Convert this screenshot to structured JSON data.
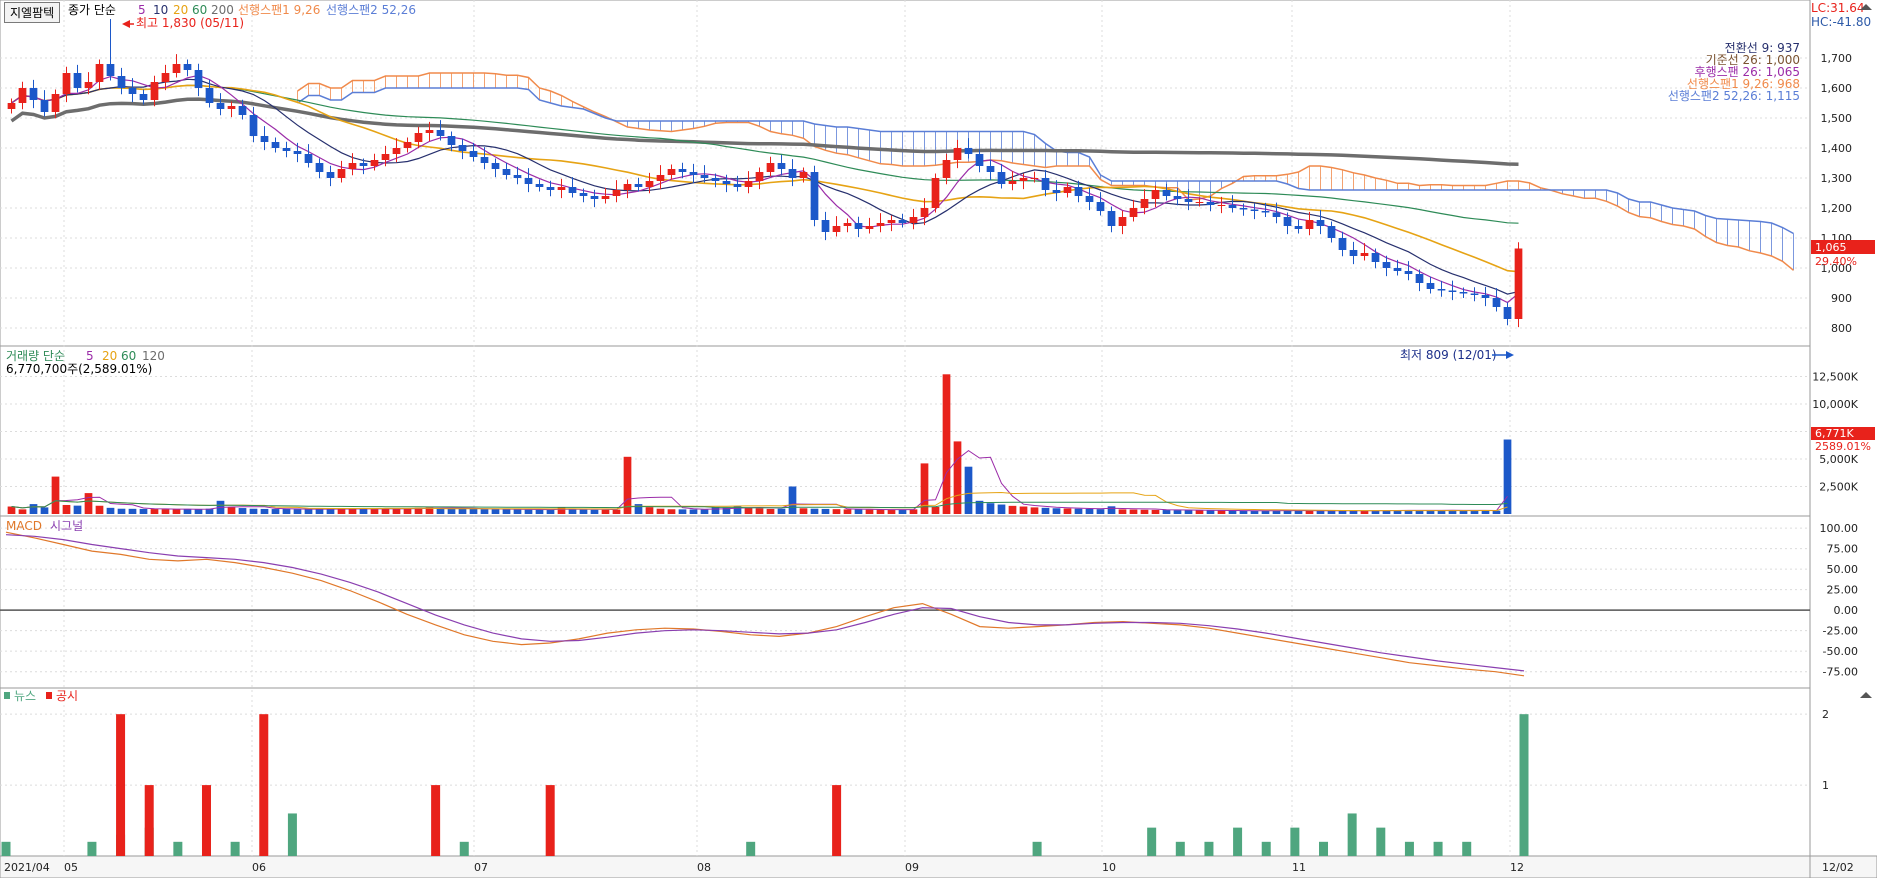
{
  "header": {
    "indicator_button": "지엘팜텍",
    "price_legend_label": "종가 단순",
    "ma_periods": [
      "5",
      "10",
      "20",
      "60",
      "200"
    ],
    "ichimoku_span1_label": "선행스팬1 9,26",
    "ichimoku_span2_label": "선행스팬2 52,26",
    "high_annotation": "최고 1,830 (05/11)",
    "low_annotation": "최저 809 (12/01)",
    "lc_label": "LC:31.64",
    "hc_label": "HC:-41.80"
  },
  "ichimoku_legend": [
    "전환선 9: 937",
    "기준선 26: 1,000",
    "후행스팬 26: 1,065",
    "선행스팬1 9,26: 968",
    "선행스팬2 52,26: 1,115"
  ],
  "current_price": {
    "value": "1,065",
    "change": "29.40%"
  },
  "volume_panel": {
    "legend_label": "거래량 단순",
    "ma_periods": [
      "5",
      "20",
      "60",
      "120"
    ],
    "summary": "6,770,700주(2,589.01%)",
    "current_value": "6,771K",
    "current_change": "2589.01%"
  },
  "macd_panel": {
    "label": "MACD",
    "signal_label": "시그널"
  },
  "news_panel": {
    "news_label": "뉴스",
    "disclosure_label": "공시"
  },
  "colors": {
    "up": "#e8221b",
    "down": "#1c58c9",
    "ma5": "#9b2ca8",
    "ma10": "#27306e",
    "ma20": "#e6a314",
    "ma60": "#2e8b57",
    "ma200": "#6d6d6d",
    "span1": "#f08a4b",
    "span2": "#5b7ed6",
    "macd": "#8a3fb0",
    "signal": "#e0782a",
    "news": "#4fa67f",
    "disclosure": "#e8221b",
    "grid": "#dcdcdc"
  },
  "chart_data": [
    {
      "type": "candlestick",
      "title": "지엘팜텍",
      "x_ticks": [
        "2021/04",
        "05",
        "06",
        "07",
        "08",
        "09",
        "10",
        "11",
        "12",
        "12/02"
      ],
      "y_ticks": [
        "1,700",
        "1,600",
        "1,500",
        "1,400",
        "1,300",
        "1,200",
        "1,100",
        "1,000",
        "900",
        "800"
      ],
      "ylim": [
        760,
        1760
      ],
      "high": 1830,
      "low": 809,
      "last_close": 1065,
      "close": [
        1550,
        1600,
        1560,
        1520,
        1580,
        1650,
        1600,
        1620,
        1680,
        1640,
        1600,
        1580,
        1560,
        1620,
        1650,
        1680,
        1660,
        1600,
        1550,
        1530,
        1540,
        1510,
        1440,
        1420,
        1400,
        1390,
        1380,
        1350,
        1320,
        1300,
        1330,
        1350,
        1340,
        1360,
        1380,
        1400,
        1420,
        1450,
        1460,
        1440,
        1410,
        1390,
        1370,
        1350,
        1330,
        1310,
        1300,
        1280,
        1270,
        1260,
        1270,
        1250,
        1240,
        1230,
        1240,
        1260,
        1280,
        1270,
        1290,
        1310,
        1330,
        1320,
        1310,
        1300,
        1290,
        1280,
        1270,
        1290,
        1320,
        1350,
        1330,
        1300,
        1320,
        1160,
        1120,
        1140,
        1150,
        1130,
        1140,
        1150,
        1160,
        1150,
        1170,
        1200,
        1300,
        1360,
        1400,
        1380,
        1340,
        1320,
        1280,
        1290,
        1300,
        1300,
        1260,
        1250,
        1270,
        1240,
        1220,
        1190,
        1140,
        1170,
        1200,
        1230,
        1260,
        1240,
        1230,
        1220,
        1220,
        1210,
        1210,
        1200,
        1195,
        1190,
        1185,
        1170,
        1140,
        1130,
        1160,
        1140,
        1100,
        1060,
        1040,
        1050,
        1020,
        1000,
        990,
        980,
        950,
        930,
        925,
        920,
        915,
        910,
        900,
        870,
        830,
        1065
      ],
      "volume_k": [
        680,
        420,
        900,
        600,
        3400,
        820,
        760,
        1900,
        750,
        560,
        480,
        470,
        460,
        450,
        440,
        420,
        460,
        430,
        480,
        1200,
        620,
        540,
        480,
        460,
        450,
        470,
        440,
        430,
        420,
        450,
        520,
        460,
        470,
        440,
        460,
        480,
        520,
        560,
        600,
        540,
        500,
        470,
        460,
        440,
        430,
        420,
        410,
        400,
        390,
        380,
        600,
        420,
        400,
        380,
        390,
        400,
        5200,
        900,
        620,
        480,
        430,
        420,
        410,
        400,
        600,
        560,
        700,
        580,
        520,
        460,
        480,
        2500,
        520,
        480,
        460,
        440,
        420,
        410,
        400,
        390,
        380,
        400,
        420,
        4600,
        640,
        12700,
        6600,
        4300,
        1200,
        980,
        860,
        740,
        680,
        600,
        560,
        520,
        500,
        480,
        460,
        440,
        700,
        420,
        400,
        380,
        370,
        360,
        350,
        340,
        330,
        320,
        310,
        300,
        300,
        290,
        300,
        310,
        330,
        300,
        290,
        280,
        280,
        290,
        300,
        310,
        320,
        320,
        330,
        340,
        320,
        310,
        350,
        340,
        330,
        320,
        310,
        300,
        6771
      ],
      "volume_ticks": [
        "12,500K",
        "10,000K",
        "7,500K",
        "5,000K",
        "2,500K"
      ]
    },
    {
      "type": "line",
      "title": "MACD",
      "y_ticks": [
        "100.00",
        "75.00",
        "50.00",
        "25.00",
        "0.00",
        "-25.00",
        "-50.00",
        "-75.00"
      ],
      "ylim": [
        -90,
        105
      ],
      "series": [
        {
          "name": "MACD",
          "values": [
            95,
            88,
            80,
            72,
            68,
            62,
            60,
            62,
            58,
            52,
            45,
            36,
            24,
            10,
            -5,
            -18,
            -30,
            -38,
            -42,
            -40,
            -35,
            -28,
            -24,
            -22,
            -23,
            -26,
            -30,
            -32,
            -28,
            -20,
            -8,
            3,
            8,
            -5,
            -20,
            -22,
            -20,
            -18,
            -15,
            -14,
            -16,
            -18,
            -22,
            -28,
            -34,
            -40,
            -46,
            -52,
            -58,
            -64,
            -68,
            -72,
            -75,
            -80
          ]
        },
        {
          "name": "시그널",
          "values": [
            92,
            90,
            86,
            80,
            75,
            70,
            66,
            64,
            62,
            58,
            52,
            44,
            34,
            22,
            8,
            -6,
            -18,
            -28,
            -35,
            -38,
            -37,
            -33,
            -28,
            -25,
            -24,
            -25,
            -27,
            -29,
            -28,
            -24,
            -15,
            -5,
            3,
            2,
            -8,
            -15,
            -18,
            -18,
            -16,
            -15,
            -15,
            -16,
            -19,
            -23,
            -28,
            -34,
            -40,
            -46,
            -52,
            -57,
            -62,
            -66,
            -70,
            -74
          ]
        }
      ]
    },
    {
      "type": "bar",
      "title": "뉴스 / 공시",
      "y_ticks": [
        "2",
        "1"
      ],
      "ylim": [
        0,
        2.2
      ],
      "series": [
        {
          "name": "뉴스",
          "values": [
            0.2,
            0,
            0,
            0.2,
            0.3,
            0.4,
            0.2,
            0,
            0.2,
            0,
            0.6,
            0,
            0,
            0,
            0,
            0,
            0.2,
            0,
            0,
            0,
            0,
            0,
            0,
            0,
            0,
            0,
            0.2,
            0,
            0,
            0,
            0,
            0,
            0,
            0,
            0,
            0,
            0.2,
            0,
            0,
            0,
            0.4,
            0.2,
            0.2,
            0.4,
            0.2,
            0.4,
            0.2,
            0.6,
            0.4,
            0.2,
            0.2,
            0.2,
            0,
            2
          ]
        },
        {
          "name": "공시",
          "values": [
            0,
            0,
            0,
            0,
            2,
            1,
            0,
            1,
            0,
            2,
            0,
            0,
            0,
            0,
            0,
            1,
            0,
            0,
            0,
            1,
            0,
            0,
            0,
            0,
            0,
            0,
            0,
            0,
            0,
            1,
            0,
            0,
            0,
            0,
            0,
            0,
            0,
            0,
            0,
            0,
            0,
            0,
            0,
            0,
            0,
            0,
            0,
            0,
            0,
            0,
            0,
            0,
            0,
            0
          ]
        }
      ]
    }
  ]
}
